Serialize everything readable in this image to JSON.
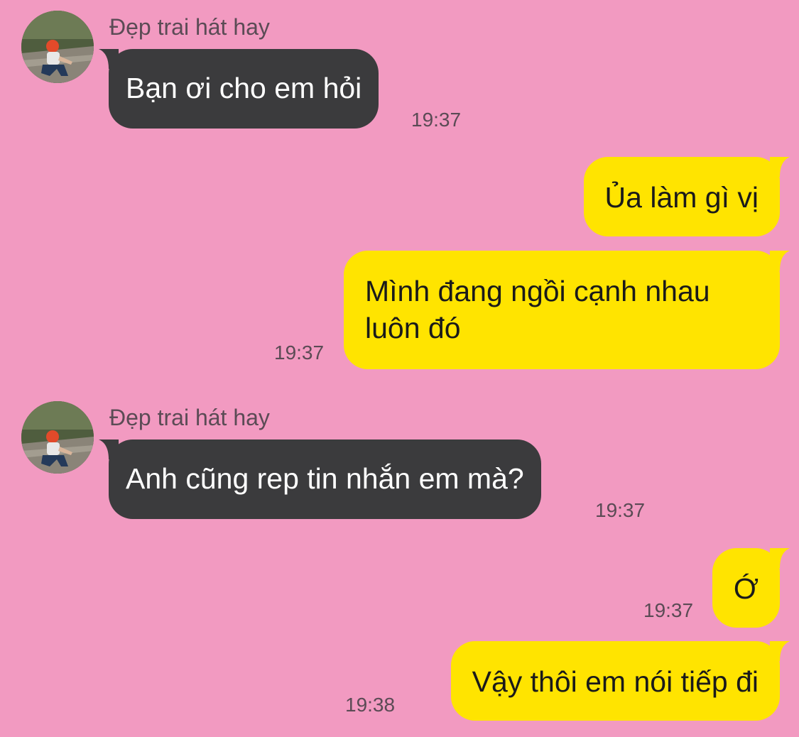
{
  "theme": {
    "background": "#f29ac1",
    "incoming_bubble": "#3b3b3d",
    "outgoing_bubble": "#ffe400",
    "meta_text": "#5b4b55"
  },
  "messages": [
    {
      "direction": "incoming",
      "sender": "Đẹp trai hát hay",
      "avatar": "profile-photo",
      "text": "Bạn ơi cho em hỏi",
      "time": "19:37"
    },
    {
      "direction": "outgoing",
      "text": "Ủa làm gì vị",
      "time": ""
    },
    {
      "direction": "outgoing",
      "text": "Mình đang ngồi cạnh nhau luôn đó",
      "time": "19:37"
    },
    {
      "direction": "incoming",
      "sender": "Đẹp trai hát hay",
      "avatar": "profile-photo",
      "text": "Anh cũng rep tin nhắn em mà?",
      "time": "19:37"
    },
    {
      "direction": "outgoing",
      "text": "Ớ",
      "time": "19:37"
    },
    {
      "direction": "outgoing",
      "text": "Vậy thôi em nói tiếp đi",
      "time": "19:38"
    }
  ]
}
